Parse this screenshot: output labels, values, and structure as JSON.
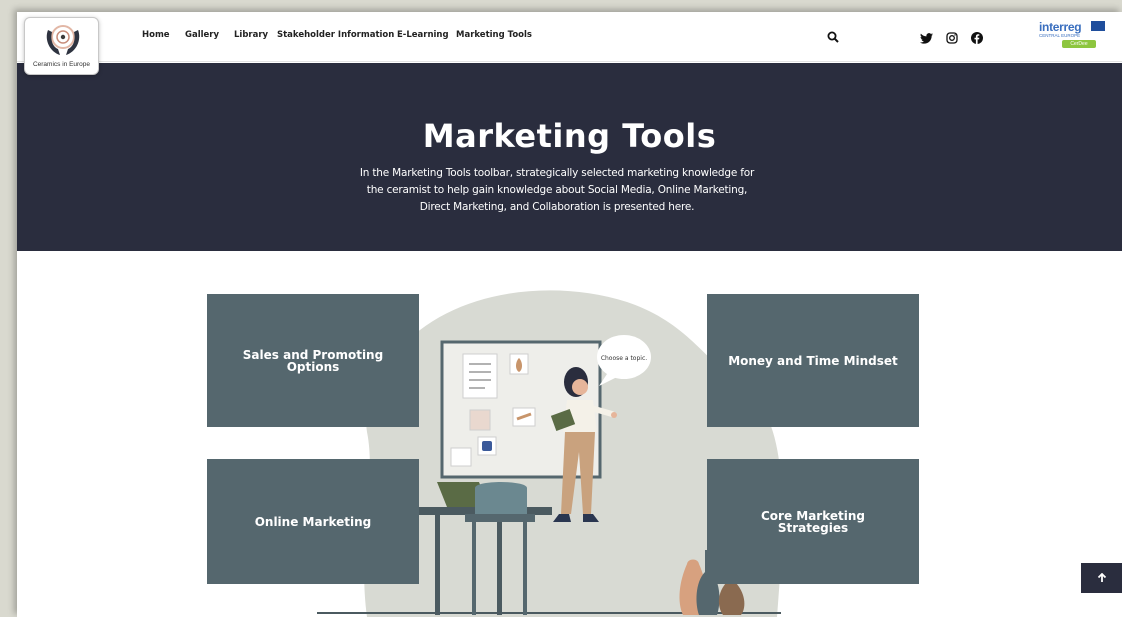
{
  "brand": {
    "logo_text": "Ceramics in Europe"
  },
  "nav": {
    "items": [
      {
        "label": "Home"
      },
      {
        "label": "Gallery"
      },
      {
        "label": "Library"
      },
      {
        "label": "Stakeholder Information"
      },
      {
        "label": "E-Learning"
      },
      {
        "label": "Marketing Tools"
      }
    ]
  },
  "header_icons": {
    "search": "search-icon",
    "social": [
      "twitter-icon",
      "instagram-icon",
      "facebook-icon"
    ]
  },
  "partner": {
    "name": "interreg",
    "subtitle": "CENTRAL EUROPE",
    "tag": "CerDee"
  },
  "hero": {
    "title": "Marketing Tools",
    "description": "In the Marketing Tools toolbar, strategically selected marketing knowledge for the ceramist to help gain knowledge about Social Media, Online Marketing, Direct Marketing, and Collaboration is presented here."
  },
  "cards": [
    {
      "label": "Sales and Promoting Options"
    },
    {
      "label": "Money and Time Mindset"
    },
    {
      "label": "Online Marketing"
    },
    {
      "label": "Core Marketing Strategies"
    }
  ],
  "illustration": {
    "speech_bubble": "Choose a topic."
  },
  "colors": {
    "hero_bg": "#2a2d3e",
    "card_bg": "#55676e",
    "tag_green": "#8dc63f"
  }
}
